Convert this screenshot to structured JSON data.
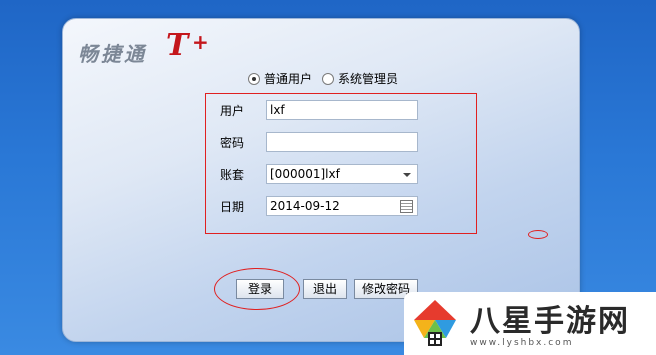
{
  "logo": {
    "text": "畅捷通",
    "t": "T",
    "plus": "+"
  },
  "user_type": {
    "options": [
      {
        "label": "普通用户",
        "checked": true
      },
      {
        "label": "系统管理员",
        "checked": false
      }
    ]
  },
  "form": {
    "user_label": "用户",
    "user_value": "lxf",
    "password_label": "密码",
    "password_value": "",
    "account_label": "账套",
    "account_value": "[000001]lxf",
    "date_label": "日期",
    "date_value": "2014-09-12"
  },
  "buttons": {
    "login": "登录",
    "exit": "退出",
    "change_password": "修改密码"
  },
  "watermark": {
    "title": "八星手游网",
    "url": "www.lyshbx.com"
  },
  "colors": {
    "annotation": "#e02020",
    "brand": "#c4161c"
  }
}
